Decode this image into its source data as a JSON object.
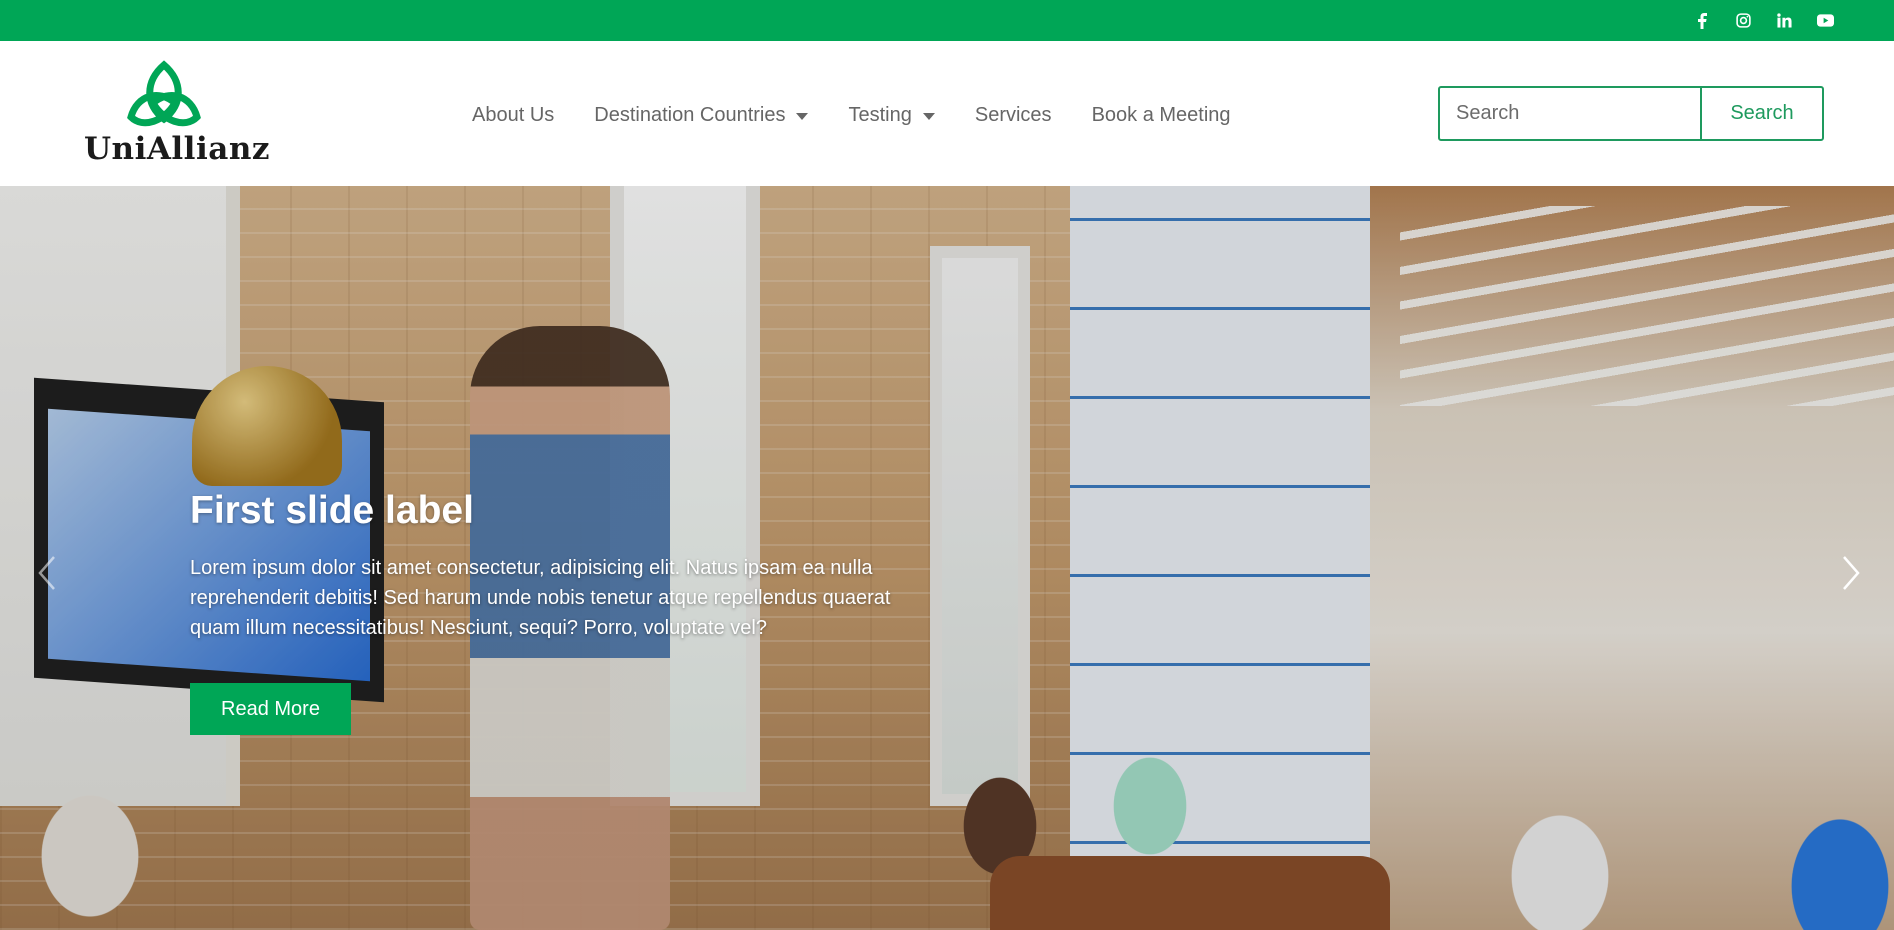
{
  "topbar": {
    "social_icons": [
      "facebook-icon",
      "instagram-icon",
      "linkedin-icon",
      "youtube-icon"
    ],
    "color": "#00a656"
  },
  "brand": {
    "name": "UniAllianz",
    "accent": "#00a656"
  },
  "nav": {
    "items": [
      {
        "label": "About Us",
        "dropdown": false
      },
      {
        "label": "Destination Countries",
        "dropdown": true
      },
      {
        "label": "Testing",
        "dropdown": true
      },
      {
        "label": "Services",
        "dropdown": false
      },
      {
        "label": "Book a Meeting",
        "dropdown": false
      }
    ]
  },
  "search": {
    "placeholder": "Search",
    "button_label": "Search"
  },
  "carousel": {
    "slide_title": "First slide label",
    "slide_text": "Lorem ipsum dolor sit amet consectetur, adipisicing elit. Natus ipsam ea nulla reprehenderit debitis! Sed harum unde nobis tenetur atque repellendus quaerat quam illum necessitatibus! Nesciunt, sequi? Porro, voluptate vel?",
    "button_label": "Read More",
    "prev_icon": "chevron-left-icon",
    "next_icon": "chevron-right-icon"
  }
}
